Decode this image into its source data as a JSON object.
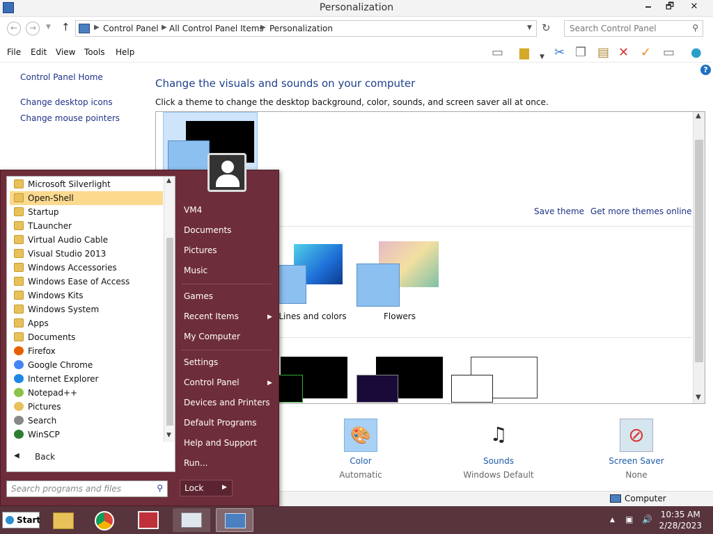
{
  "window": {
    "title": "Personalization",
    "min_label": "🗕",
    "max_label": "🗗",
    "close_label": "✕"
  },
  "address": {
    "crumbs": [
      "Control Panel",
      "All Control Panel Items",
      "Personalization"
    ],
    "search_placeholder": "Search Control Panel"
  },
  "menu": {
    "file": "File",
    "edit": "Edit",
    "view": "View",
    "tools": "Tools",
    "help": "Help"
  },
  "left": {
    "home": "Control Panel Home",
    "desktop_icons": "Change desktop icons",
    "mouse_pointers": "Change mouse pointers"
  },
  "main": {
    "heading": "Change the visuals and sounds on your computer",
    "subtext": "Click a theme to change the desktop background, color, sounds, and screen saver all at once.",
    "save_theme": "Save theme",
    "get_more": "Get more themes online",
    "theme_lines": "Lines and colors",
    "theme_flowers": "Flowers"
  },
  "settings": {
    "color_label": "Color",
    "color_sub": "Automatic",
    "sounds_label": "Sounds",
    "sounds_sub": "Windows Default",
    "saver_label": "Screen Saver",
    "saver_sub": "None"
  },
  "status": {
    "location": "Computer"
  },
  "startmenu": {
    "programs": [
      {
        "label": "Microsoft Silverlight",
        "icon": "folder-icon"
      },
      {
        "label": "Open-Shell",
        "icon": "folder-icon",
        "selected": true
      },
      {
        "label": "Startup",
        "icon": "folder-icon"
      },
      {
        "label": "TLauncher",
        "icon": "folder-icon"
      },
      {
        "label": "Virtual Audio Cable",
        "icon": "folder-icon"
      },
      {
        "label": "Visual Studio 2013",
        "icon": "folder-icon"
      },
      {
        "label": "Windows Accessories",
        "icon": "folder-icon"
      },
      {
        "label": "Windows Ease of Access",
        "icon": "folder-icon"
      },
      {
        "label": "Windows Kits",
        "icon": "folder-icon"
      },
      {
        "label": "Windows System",
        "icon": "folder-icon"
      },
      {
        "label": "Apps",
        "icon": "folder-icon"
      },
      {
        "label": "Documents",
        "icon": "folder-icon"
      },
      {
        "label": "Firefox",
        "icon": "firefox-icon"
      },
      {
        "label": "Google Chrome",
        "icon": "chrome-icon"
      },
      {
        "label": "Internet Explorer",
        "icon": "ie-icon"
      },
      {
        "label": "Notepad++",
        "icon": "notepadpp-icon"
      },
      {
        "label": "Pictures",
        "icon": "pictures-icon"
      },
      {
        "label": "Search",
        "icon": "search-icon"
      },
      {
        "label": "WinSCP",
        "icon": "winscp-icon"
      }
    ],
    "back": "Back",
    "search_placeholder": "Search programs and files",
    "right": {
      "user": "VM4",
      "documents": "Documents",
      "pictures": "Pictures",
      "music": "Music",
      "games": "Games",
      "recent": "Recent Items",
      "computer": "My Computer",
      "settings": "Settings",
      "control_panel": "Control Panel",
      "devices": "Devices and Printers",
      "defaults": "Default Programs",
      "help": "Help and Support",
      "run": "Run..."
    },
    "lock": "Lock"
  },
  "taskbar": {
    "start": "Start",
    "time": "10:35 AM",
    "date": "2/28/2023"
  },
  "colors": {
    "accent": "#6e2d3a",
    "taskbar": "#58343d",
    "link": "#1e3287",
    "selection": "#fbd98f"
  }
}
